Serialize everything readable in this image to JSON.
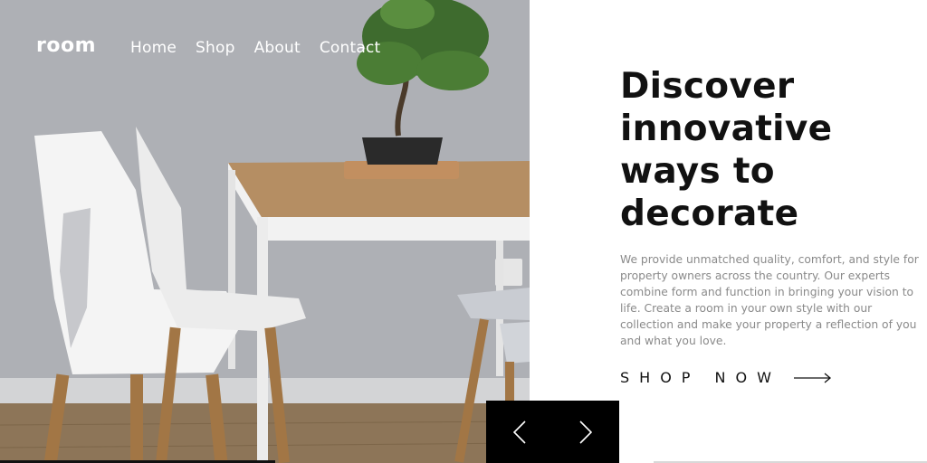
{
  "brand": {
    "logo_text": "room"
  },
  "nav": {
    "items": [
      {
        "label": "Home"
      },
      {
        "label": "Shop"
      },
      {
        "label": "About"
      },
      {
        "label": "Contact"
      }
    ]
  },
  "hero": {
    "image_alt": "White chairs around a wooden table with a bonsai plant",
    "headline": [
      "Discover",
      "innovative",
      "ways to",
      "decorate"
    ],
    "description": "We provide unmatched quality, comfort, and style for property owners across the country. Our experts combine form and function in bringing your vision to life. Create a room in your own style with our collection and make your property a reflection of you and what you love.",
    "cta_label": "SHOP NOW"
  },
  "slider": {
    "prev_icon": "chevron-left-icon",
    "next_icon": "chevron-right-icon"
  },
  "colors": {
    "text_dark": "#111111",
    "text_muted": "#8a8a8a",
    "controls_bg": "#000000",
    "nav_text": "#ffffff"
  }
}
